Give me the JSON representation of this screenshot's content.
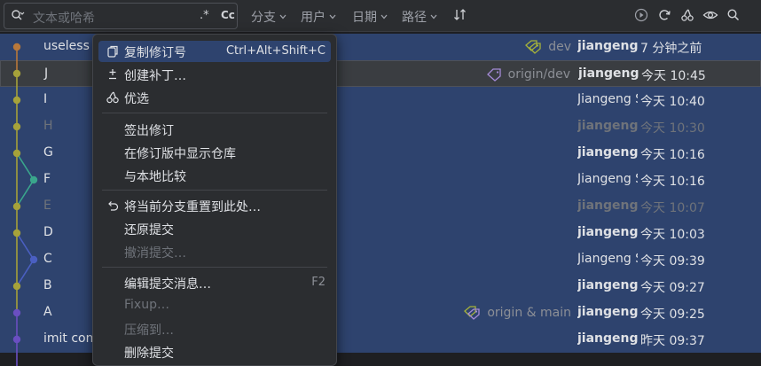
{
  "toolbar": {
    "search_placeholder": "文本或哈希",
    "regex_label": ".*",
    "case_label": "Cc",
    "filters": {
      "branch": "分支",
      "user": "用户",
      "date": "日期",
      "path": "路径"
    }
  },
  "commits": [
    {
      "subject": "useless",
      "refs": "dev",
      "author": "jiangeng",
      "author_bold": true,
      "date": "7 分钟之前"
    },
    {
      "subject": "J",
      "refs": "origin/dev",
      "author": "jiangeng",
      "author_bold": true,
      "date": "今天 10:45"
    },
    {
      "subject": "I",
      "refs": "",
      "author": "Jiangeng S",
      "author_bold": false,
      "date": "今天 10:40"
    },
    {
      "subject": "H",
      "refs": "",
      "author": "jiangeng",
      "author_bold": true,
      "date": "今天 10:30"
    },
    {
      "subject": "G",
      "refs": "",
      "author": "jiangeng",
      "author_bold": true,
      "date": "今天 10:16"
    },
    {
      "subject": "F",
      "refs": "",
      "author": "Jiangeng S",
      "author_bold": false,
      "date": "今天 10:16"
    },
    {
      "subject": "E",
      "refs": "",
      "author": "jiangeng",
      "author_bold": true,
      "date": "今天 10:07"
    },
    {
      "subject": "D",
      "refs": "",
      "author": "jiangeng",
      "author_bold": true,
      "date": "今天 10:03"
    },
    {
      "subject": "C",
      "refs": "",
      "author": "Jiangeng S",
      "author_bold": false,
      "date": "今天 09:39"
    },
    {
      "subject": "B",
      "refs": "",
      "author": "jiangeng",
      "author_bold": true,
      "date": "今天 09:27"
    },
    {
      "subject": "A",
      "refs": "origin & main",
      "author": "jiangeng",
      "author_bold": true,
      "date": "今天 09:25"
    },
    {
      "subject": "imit com",
      "refs": "",
      "author": "jiangeng",
      "author_bold": true,
      "date": "昨天 09:37"
    }
  ],
  "menu": {
    "copy_revision": "复制修订号",
    "copy_revision_shortcut": "Ctrl+Alt+Shift+C",
    "create_patch": "创建补丁…",
    "cherry_pick": "优选",
    "checkout_revision": "签出修订",
    "show_repo_at_revision": "在修订版中显示仓库",
    "compare_with_local": "与本地比较",
    "reset_branch": "将当前分支重置到此处…",
    "revert_commit": "还原提交",
    "undo_commit": "撤消提交…",
    "edit_message": "编辑提交消息…",
    "edit_message_shortcut": "F2",
    "fixup": "Fixup…",
    "squash_into": "压缩到…",
    "drop_commits": "删除提交"
  },
  "colors": {
    "selection": "#2e436e",
    "branch_main": "#a6a23a",
    "branch_orange": "#b9783a",
    "branch_teal": "#3aa68c",
    "branch_blue": "#4a5fc1",
    "branch_purple": "#6a4fc1",
    "tag_green": "#a6b33a",
    "tag_purple": "#a58bd8"
  }
}
